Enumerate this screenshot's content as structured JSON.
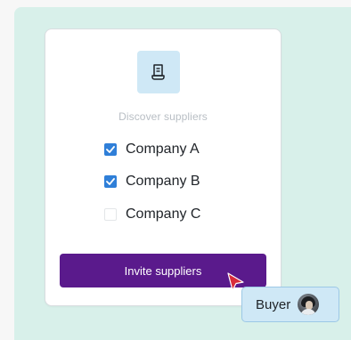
{
  "card": {
    "heading": "Discover suppliers",
    "icon": "receipt-document-icon",
    "options": [
      {
        "label": "Company A",
        "checked": true
      },
      {
        "label": "Company B",
        "checked": true
      },
      {
        "label": "Company C",
        "checked": false
      }
    ],
    "button_label": "Invite suppliers"
  },
  "buyer_tag": {
    "label": "Buyer",
    "avatar": "buyer-avatar"
  },
  "colors": {
    "background_panel": "#d8f0ea",
    "icon_tile": "#cfe8f6",
    "checkbox_checked": "#2f7fd8",
    "button": "#5a1a8c",
    "cursor": "#d92b3a"
  }
}
